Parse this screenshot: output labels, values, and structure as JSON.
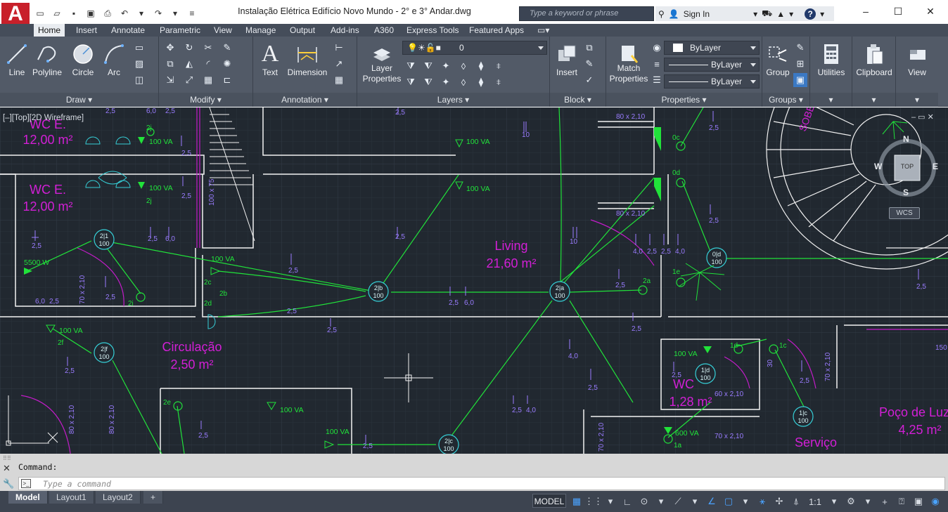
{
  "app": {
    "logo_letter": "A",
    "title": "Instalação Elétrica Edifício Novo Mundo - 2° e 3° Andar.dwg",
    "search_placeholder": "Type a keyword or phrase",
    "sign_in": "Sign In",
    "help": "?"
  },
  "ribbon": {
    "tabs": [
      "Home",
      "Insert",
      "Annotate",
      "Parametric",
      "View",
      "Manage",
      "Output",
      "Add-ins",
      "A360",
      "Express Tools",
      "Featured Apps"
    ],
    "active_tab": "Home",
    "panels": {
      "draw": {
        "title": "Draw",
        "tools": [
          "Line",
          "Polyline",
          "Circle",
          "Arc"
        ]
      },
      "modify": {
        "title": "Modify"
      },
      "annotation": {
        "title": "Annotation",
        "tools": [
          "Text",
          "Dimension"
        ]
      },
      "layers": {
        "title": "Layers",
        "layer_properties": "Layer\nProperties",
        "current_layer": "0"
      },
      "block": {
        "title": "Block",
        "insert": "Insert"
      },
      "properties": {
        "title": "Properties",
        "match": "Match\nProperties",
        "color": "ByLayer",
        "linetype": "ByLayer",
        "lineweight": "ByLayer"
      },
      "groups": {
        "title": "Groups",
        "group": "Group"
      },
      "utilities": {
        "label": "Utilities"
      },
      "clipboard": {
        "label": "Clipboard"
      },
      "view": {
        "label": "View"
      }
    }
  },
  "viewport": {
    "label": "[–][Top][2D Wireframe]",
    "viewcube": {
      "top": "TOP",
      "n": "N",
      "s": "S",
      "e": "E",
      "w": "W",
      "wcs": "WCS"
    }
  },
  "drawing": {
    "rooms": [
      {
        "name": "WC E.",
        "area": "12,00 m²"
      },
      {
        "name": "WC E.",
        "area": "12,00 m²"
      },
      {
        "name": "Living",
        "area": "21,60 m²"
      },
      {
        "name": "Circulação",
        "area": "2,50 m²"
      },
      {
        "name": "WC",
        "area": "1,28 m²"
      },
      {
        "name": "Poço de Luz",
        "area": "4,25 m²"
      },
      {
        "name": "Serviço",
        "area": ""
      }
    ],
    "labels": {
      "va100": "100 VA",
      "va5500": "5500 W",
      "va600": "600 VA",
      "dim80x210": "80 x 2,10",
      "dim70x210": "70 x 2,10",
      "dim60x210": "60 x 2,10",
      "dim100x75": "100 x 75",
      "sobe": "SOBE",
      "h25": "2,5",
      "h60": "6,0",
      "h40": "4,0",
      "num10": "10",
      "num150": "150",
      "num30": "30",
      "num100": "100"
    },
    "circuits": [
      "2|1",
      "2|f",
      "2|b",
      "2|a",
      "2|c",
      "0|d",
      "1|d",
      "1|c"
    ],
    "tags": [
      "2j",
      "2i",
      "2c",
      "2d",
      "2f",
      "2e",
      "0c",
      "0d",
      "1e",
      "1d",
      "1c",
      "1a",
      "2a",
      "2b"
    ]
  },
  "command": {
    "history": "Command:",
    "placeholder": "Type a command"
  },
  "status": {
    "layout_tabs": [
      "Model",
      "Layout1",
      "Layout2"
    ],
    "active_layout": "Model",
    "add_tab": "+",
    "model_button": "MODEL",
    "scale": "1:1"
  },
  "colors": {
    "canvas_bg": "#212830",
    "wall": "#f2f2f2",
    "circuit": "#21e23a",
    "fixture": "#36d0d8",
    "text_room": "#d21fd6",
    "text_dim": "#9a7cff"
  }
}
